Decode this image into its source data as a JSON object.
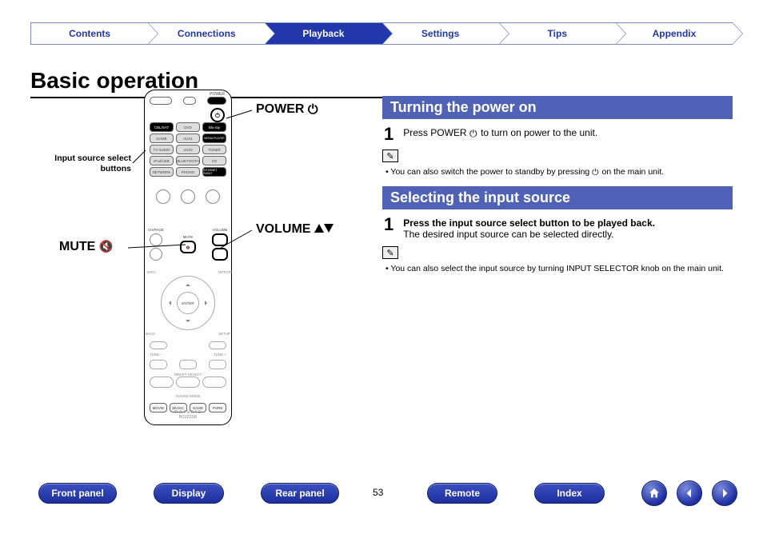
{
  "topnav": {
    "tabs": [
      {
        "label": "Contents"
      },
      {
        "label": "Connections"
      },
      {
        "label": "Playback"
      },
      {
        "label": "Settings"
      },
      {
        "label": "Tips"
      },
      {
        "label": "Appendix"
      }
    ],
    "active_index": 2
  },
  "title": "Basic operation",
  "remote_labels": {
    "power": "POWER",
    "volume": "VOLUME",
    "mute": "MUTE",
    "input_source": "Input source\nselect buttons"
  },
  "remote": {
    "top_row_power_label": "POWER",
    "input_rows": [
      [
        "CBL/SAT",
        "DVD",
        "Blu-ray"
      ],
      [
        "GAME",
        "AUX1",
        "MEDIA PLAYER"
      ],
      [
        "TV AUDIO",
        "AUX2",
        "TUNER"
      ],
      [
        "iPod/USB",
        "BLUETOOTH",
        "CD"
      ],
      [
        "NETWORK",
        "PHONO",
        "INTERNET RADIO"
      ]
    ],
    "vol_labels": {
      "ch": "CH/PAGE",
      "mute": "MUTE",
      "volume": "VOLUME"
    },
    "dpad_center": "ENTER",
    "dpad_back": "BACK",
    "dpad_info": "INFO",
    "dpad_option": "OPTION",
    "dpad_setup": "SETUP",
    "tune_minus": "TUNE –",
    "tune_plus": "TUNE +",
    "smart_select": "SMART SELECT",
    "sound_mode": "SOUND MODE",
    "sound_mode_btns": [
      "MOVIE",
      "MUSIC",
      "GAME",
      "PURE"
    ],
    "brand": "marantz",
    "model": "RC022SR"
  },
  "sections": [
    {
      "heading": "Turning the power on",
      "step_num": "1",
      "step_html_pre": "Press POWER ",
      "step_html_post": " to turn on power to the unit.",
      "note_pre": "You can also switch the power to standby by pressing ",
      "note_post": " on the main unit."
    },
    {
      "heading": "Selecting the input source",
      "step_num": "1",
      "step_bold": "Press the input source select button to be played back.",
      "step_sub": "The desired input source can be selected directly.",
      "note": "You can also select the input source by turning INPUT SELECTOR knob on the main unit."
    }
  ],
  "footer": {
    "buttons": [
      {
        "label": "Front panel"
      },
      {
        "label": "Display"
      },
      {
        "label": "Rear panel"
      },
      {
        "label": "Remote"
      },
      {
        "label": "Index"
      }
    ],
    "page": "53"
  }
}
